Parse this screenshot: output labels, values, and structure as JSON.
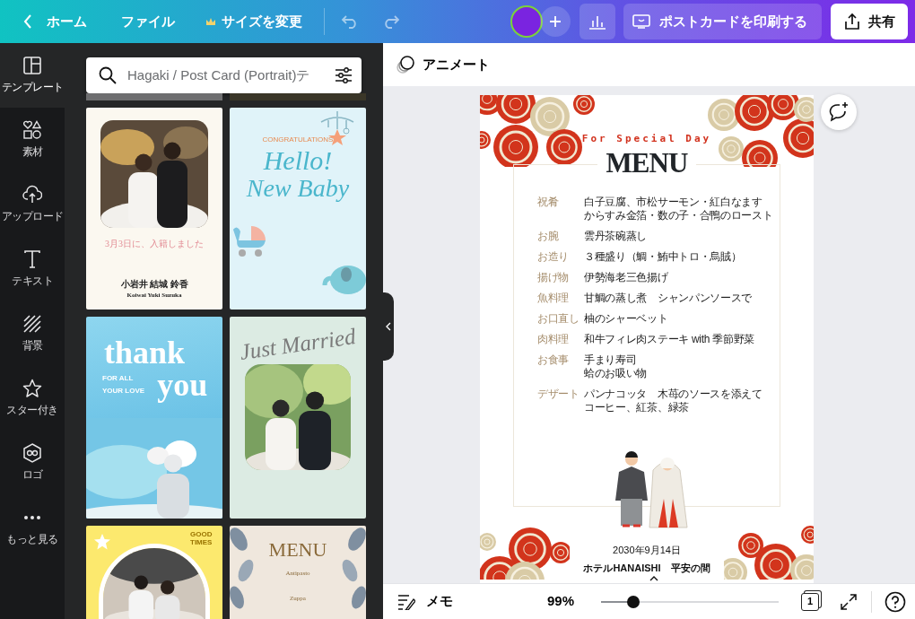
{
  "topbar": {
    "back": "ホーム",
    "menus": [
      {
        "label": "ファイル",
        "kind": "plain"
      },
      {
        "label": "サイズを変更",
        "kind": "premium"
      }
    ],
    "print": "ポストカードを印刷する",
    "share": "共有"
  },
  "sidebar": {
    "items": [
      {
        "label": "テンプレート",
        "selected": true
      },
      {
        "label": "素材",
        "selected": false
      },
      {
        "label": "アップロード",
        "selected": false
      },
      {
        "label": "テキスト",
        "selected": false
      },
      {
        "label": "背景",
        "selected": false
      },
      {
        "label": "スター付き",
        "selected": false
      },
      {
        "label": "ロゴ",
        "selected": false
      },
      {
        "label": "もっと見る",
        "selected": false
      }
    ]
  },
  "panel": {
    "search": {
      "placeholder": "Hagaki / Post Card (Portrait)テ"
    },
    "templates": [
      {
        "kind": "wedding",
        "texts": [
          "3月3日に、入籍しました",
          "小岩井 結城 鈴香",
          "Koiwai Yuki Suzuka"
        ]
      },
      {
        "kind": "baby",
        "texts": [
          "CONGRATULATIONS",
          "Hello!",
          "New Baby"
        ]
      },
      {
        "kind": "thanks",
        "texts": [
          "thank",
          "you",
          "FOR ALL",
          "YOUR LOVE"
        ]
      },
      {
        "kind": "married",
        "texts": [
          "Just Married"
        ]
      },
      {
        "kind": "family",
        "texts": [
          "GOOD TIMES"
        ]
      },
      {
        "kind": "menu",
        "texts": [
          "MENU",
          "Antipasto",
          "Zuppa"
        ]
      }
    ]
  },
  "editor": {
    "animate": "アニメート",
    "page": {
      "subtitle": "For Special Day",
      "title": "MENU",
      "courses": [
        {
          "label": "祝肴",
          "lines": [
            "白子豆腐、市松サーモン・紅白なます",
            "からすみ金箔・数の子・合鴨のロースト"
          ]
        },
        {
          "label": "お腕",
          "lines": [
            "雲丹茶碗蒸し"
          ]
        },
        {
          "label": "お造り",
          "lines": [
            "３種盛り（鯛・鮪中トロ・烏賊）"
          ]
        },
        {
          "label": "揚げ物",
          "lines": [
            "伊勢海老三色揚げ"
          ]
        },
        {
          "label": "魚料理",
          "lines": [
            "甘鯛の蒸し煮　シャンパンソースで"
          ]
        },
        {
          "label": "お口直し",
          "lines": [
            "柚のシャーベット"
          ]
        },
        {
          "label": "肉料理",
          "lines": [
            "和牛フィレ肉ステーキ with 季節野菜"
          ]
        },
        {
          "label": "お食事",
          "lines": [
            "手まり寿司",
            "蛤のお吸い物"
          ]
        },
        {
          "label": "デザート",
          "lines": [
            "パンナコッタ　木苺のソースを添えて",
            "コーヒー、紅茶、緑茶"
          ]
        }
      ],
      "date": "2030年9月14日",
      "venue": "ホテルHANAISHI　平安の間"
    }
  },
  "bottom_bar": {
    "notes": "メモ",
    "zoom": "99%",
    "level": 0.18,
    "page_number": "1"
  }
}
